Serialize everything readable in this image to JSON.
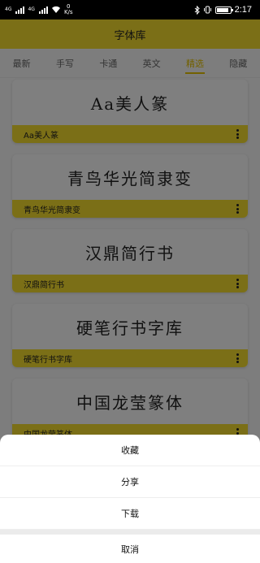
{
  "status": {
    "sim1": "4G",
    "sim2": "4G",
    "net_speed_value": "0",
    "net_speed_unit": "K/s",
    "time": "2:17",
    "battery_level": 0.9,
    "icons": [
      "signal-icon",
      "signal-icon",
      "wifi-icon",
      "bluetooth-icon",
      "vibrate-icon",
      "battery-icon"
    ]
  },
  "app": {
    "title": "字体库",
    "tabs": [
      {
        "label": "最新",
        "active": false
      },
      {
        "label": "手写",
        "active": false
      },
      {
        "label": "卡通",
        "active": false
      },
      {
        "label": "英文",
        "active": false
      },
      {
        "label": "精选",
        "active": true
      },
      {
        "label": "隐藏",
        "active": false
      }
    ],
    "accent": "#f7df2e",
    "fonts": [
      {
        "preview": "Aa美人篆",
        "name": "Aa美人篆"
      },
      {
        "preview": "青鸟华光简隶变",
        "name": "青鸟华光简隶变"
      },
      {
        "preview": "汉鼎简行书",
        "name": "汉鼎简行书"
      },
      {
        "preview": "硬笔行书字库",
        "name": "硬笔行书字库"
      },
      {
        "preview": "中国龙莹篆体",
        "name": "中国龙莹篆体"
      }
    ]
  },
  "sheet": {
    "favorite": "收藏",
    "share": "分享",
    "download": "下载",
    "cancel": "取消"
  }
}
